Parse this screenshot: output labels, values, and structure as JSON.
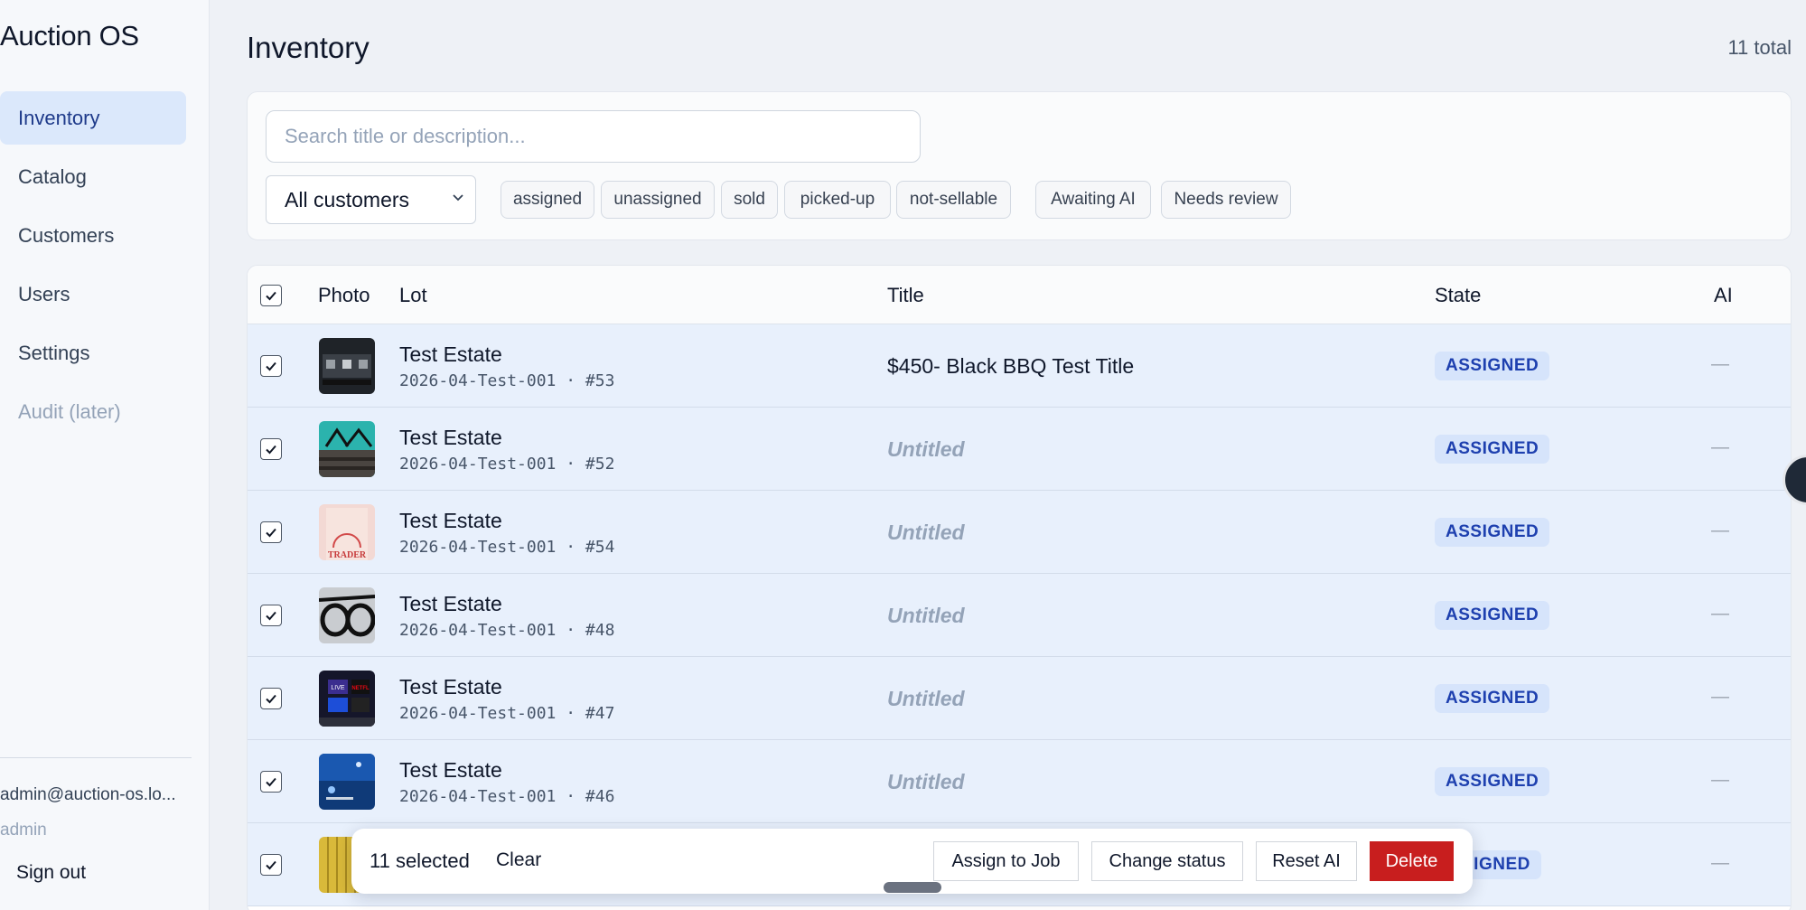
{
  "app": {
    "name": "Auction OS"
  },
  "sidebar": {
    "items": [
      {
        "label": "Inventory"
      },
      {
        "label": "Catalog"
      },
      {
        "label": "Customers"
      },
      {
        "label": "Users"
      },
      {
        "label": "Settings"
      },
      {
        "label": "Audit (later)"
      }
    ],
    "user_email": "admin@auction-os.lo...",
    "user_role": "admin",
    "sign_out": "Sign out"
  },
  "header": {
    "title": "Inventory",
    "total": "11 total"
  },
  "filters": {
    "search_placeholder": "Search title or description...",
    "customer_select": "All customers",
    "chips": [
      "assigned",
      "unassigned",
      "sold",
      "picked-up",
      "not-sellable",
      "Awaiting AI",
      "Needs review"
    ]
  },
  "table": {
    "columns": [
      "Photo",
      "Lot",
      "Title",
      "State",
      "AI"
    ],
    "rows": [
      {
        "lot": "Test Estate",
        "code": "2026-04-Test-001 · #53",
        "title": "$450- Black BBQ Test Title",
        "state": "ASSIGNED",
        "ai": "—"
      },
      {
        "lot": "Test Estate",
        "code": "2026-04-Test-001 · #52",
        "title": "Untitled",
        "state": "ASSIGNED",
        "ai": "—"
      },
      {
        "lot": "Test Estate",
        "code": "2026-04-Test-001 · #54",
        "title": "Untitled",
        "state": "ASSIGNED",
        "ai": "—"
      },
      {
        "lot": "Test Estate",
        "code": "2026-04-Test-001 · #48",
        "title": "Untitled",
        "state": "ASSIGNED",
        "ai": "—"
      },
      {
        "lot": "Test Estate",
        "code": "2026-04-Test-001 · #47",
        "title": "Untitled",
        "state": "ASSIGNED",
        "ai": "—"
      },
      {
        "lot": "Test Estate",
        "code": "2026-04-Test-001 · #46",
        "title": "Untitled",
        "state": "ASSIGNED",
        "ai": "—"
      },
      {
        "lot": "",
        "code": "",
        "title": "",
        "state": "SIGNED",
        "ai": "—"
      }
    ]
  },
  "bulk": {
    "selected": "11 selected",
    "clear": "Clear",
    "assign": "Assign to Job",
    "change_status": "Change status",
    "reset_ai": "Reset AI",
    "delete": "Delete"
  },
  "thumb_text": {
    "row3": "TRADER",
    "row5a": "LIVE",
    "row5b": "NETFL"
  },
  "colors": {
    "accent": "#1e40af",
    "active_nav": "#dbe8fb",
    "selected_row": "#e8f0fc",
    "danger": "#c81e1e"
  }
}
